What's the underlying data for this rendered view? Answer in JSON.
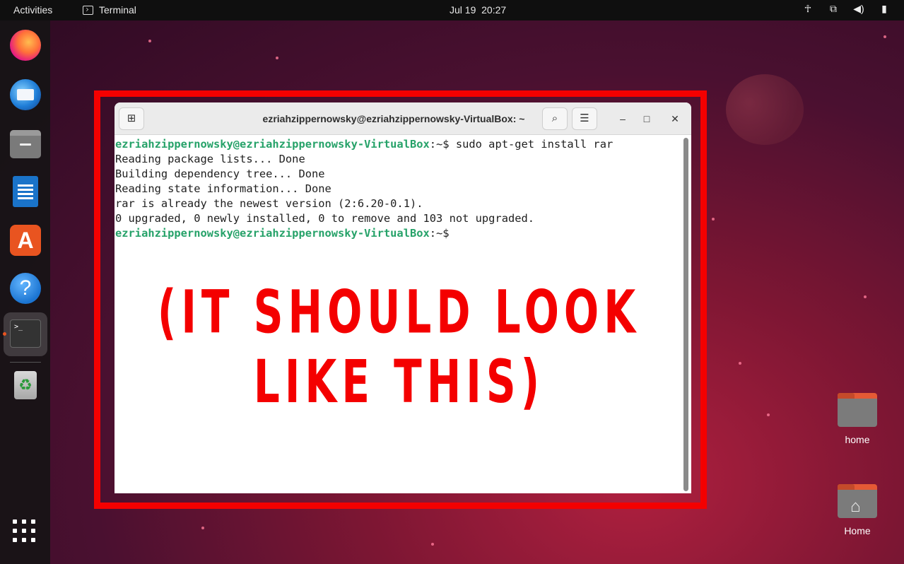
{
  "topbar": {
    "activities": "Activities",
    "app_name": "Terminal",
    "date": "Jul 19",
    "time": "20:27",
    "tray": {
      "accessibility_glyph": "☥",
      "network_glyph": "⧉",
      "volume_glyph": "◀)",
      "battery_glyph": "▮"
    }
  },
  "dock": {
    "items": [
      "firefox-icon",
      "thunderbird-icon",
      "files-icon",
      "writer-icon",
      "software-icon",
      "help-icon",
      "terminal-icon",
      "trash-icon",
      "show-apps-icon"
    ],
    "software_glyph": "A",
    "help_glyph": "?",
    "terminal_glyph": ">_",
    "trash_glyph": "♻",
    "accent_color": "#e95420"
  },
  "terminal": {
    "title": "ezriahzippernowsky@ezriahzippernowsky-VirtualBox: ~",
    "new_tab_glyph": "⊞",
    "search_glyph": "⌕",
    "menu_glyph": "☰",
    "minimize_glyph": "–",
    "maximize_glyph": "□",
    "close_glyph": "✕",
    "prompt_user": "ezriahzippernowsky@ezriahzippernowsky-VirtualBox",
    "prompt_path": ":~$ ",
    "command": "sudo apt-get install rar",
    "output": [
      "Reading package lists... Done",
      "Building dependency tree... Done",
      "Reading state information... Done",
      "rar is already the newest version (2:6.20-0.1).",
      "0 upgraded, 0 newly installed, 0 to remove and 103 not upgraded."
    ],
    "prompt_color": "#26a269"
  },
  "annotation": {
    "text": "(IT SHOULD LOOK LIKE THIS)",
    "color": "#f40000"
  },
  "desktop": {
    "icons": [
      {
        "label": "home"
      },
      {
        "label": "Home"
      }
    ],
    "house_glyph": "⌂"
  }
}
